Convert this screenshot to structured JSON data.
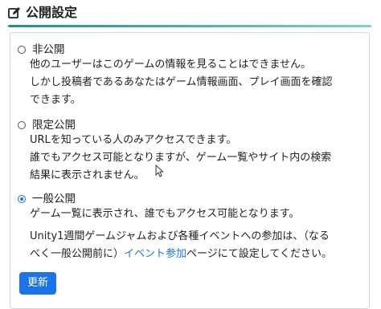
{
  "header": {
    "title": "公開設定",
    "icon": "edit-icon"
  },
  "colors": {
    "accent": "#1a73e8",
    "header_rule_start": "#1f8f8f",
    "header_rule_end": "#7bd3c8"
  },
  "options": [
    {
      "label": "非公開",
      "checked": false,
      "lines": [
        "他のユーザーはこのゲームの情報を見ることはできません。",
        "しかし投稿者であるあなたはゲーム情報画面、プレイ画面を確認",
        "できます。"
      ]
    },
    {
      "label": "限定公開",
      "checked": false,
      "lines": [
        "URLを知っている人のみアクセスできます。",
        "誰でもアクセス可能となりますが、ゲーム一覧やサイト内の検索",
        "結果に表示されません。"
      ]
    },
    {
      "label": "一般公開",
      "checked": true,
      "lines": [
        "ゲーム一覧に表示され、誰でもアクセス可能となります。"
      ],
      "note_line1": "Unity1週間ゲームジャムおよび各種イベントへの参加は、（なる",
      "note_line2_prefix": "べく一般公開前に）",
      "note_link": "イベント参加",
      "note_line2_suffix": "ページにて設定してください。"
    }
  ],
  "update_button": {
    "label": "更新"
  }
}
